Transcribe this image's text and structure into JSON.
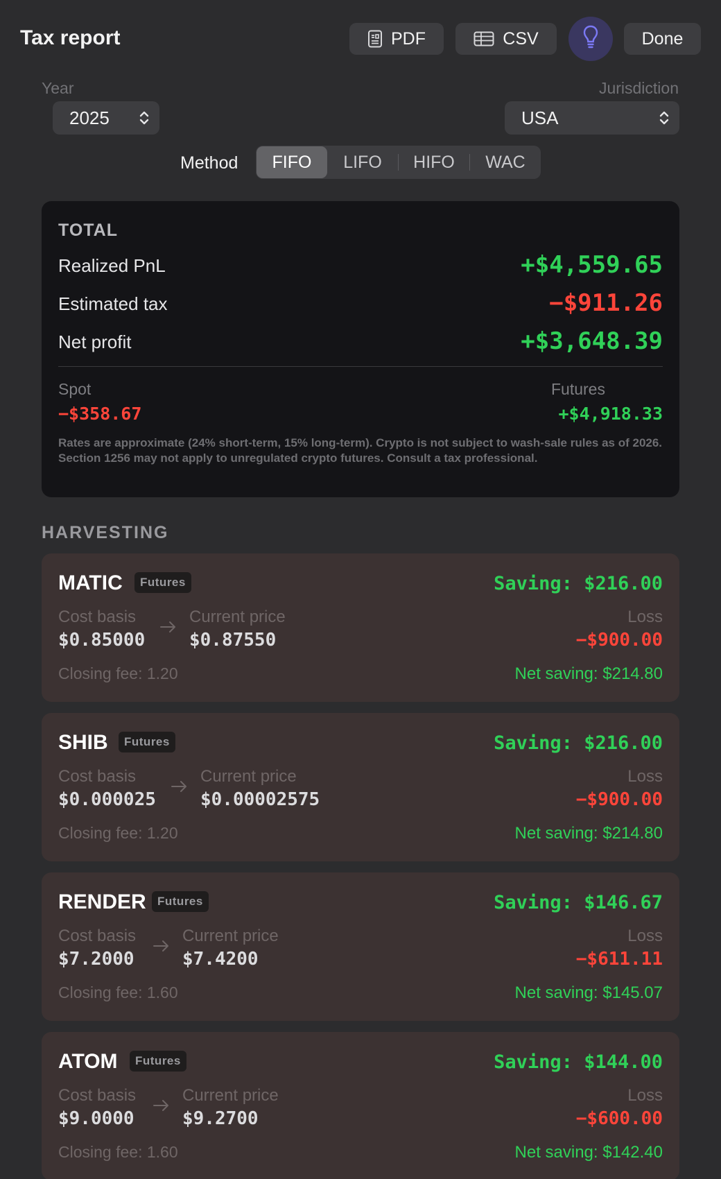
{
  "header": {
    "title": "Tax report",
    "pdf_label": "PDF",
    "csv_label": "CSV",
    "done_label": "Done",
    "bulb_color": "#6e6cf0"
  },
  "filters": {
    "year_label": "Year",
    "year_value": "2025",
    "jurisdiction_label": "Jurisdiction",
    "jurisdiction_value": "USA",
    "method_label": "Method",
    "methods": [
      "FIFO",
      "LIFO",
      "HIFO",
      "WAC"
    ],
    "selected_method": "FIFO"
  },
  "total": {
    "heading": "TOTAL",
    "realized_label": "Realized PnL",
    "realized_value": "+$4,559.65",
    "tax_label": "Estimated tax",
    "tax_value": "−$911.26",
    "net_label": "Net profit",
    "net_value": "+$3,648.39",
    "spot_label": "Spot",
    "spot_value": "−$358.67",
    "futures_label": "Futures",
    "futures_value": "+$4,918.33",
    "disclaimer": "Rates are approximate (24% short-term, 15% long-term). Crypto is not subject to wash-sale rules as of 2026. Section 1256 may not apply to unregulated crypto futures. Consult a tax professional."
  },
  "harvesting": {
    "title": "HARVESTING",
    "cost_label": "Cost basis",
    "price_label": "Current price",
    "loss_label": "Loss",
    "items": [
      {
        "symbol": "MATIC",
        "badge": "Futures",
        "saving": "Saving: $216.00",
        "cost": "$0.85000",
        "price": "$0.87550",
        "loss": "−$900.00",
        "fee": "Closing fee: 1.20",
        "net": "Net saving: $214.80"
      },
      {
        "symbol": "SHIB",
        "badge": "Futures",
        "saving": "Saving: $216.00",
        "cost": "$0.000025",
        "price": "$0.00002575",
        "loss": "−$900.00",
        "fee": "Closing fee: 1.20",
        "net": "Net saving: $214.80"
      },
      {
        "symbol": "RENDER",
        "badge": "Futures",
        "saving": "Saving: $146.67",
        "cost": "$7.2000",
        "price": "$7.4200",
        "loss": "−$611.11",
        "fee": "Closing fee: 1.60",
        "net": "Net saving: $145.07"
      },
      {
        "symbol": "ATOM",
        "badge": "Futures",
        "saving": "Saving: $144.00",
        "cost": "$9.0000",
        "price": "$9.2700",
        "loss": "−$600.00",
        "fee": "Closing fee: 1.60",
        "net": "Net saving: $142.40"
      }
    ]
  }
}
